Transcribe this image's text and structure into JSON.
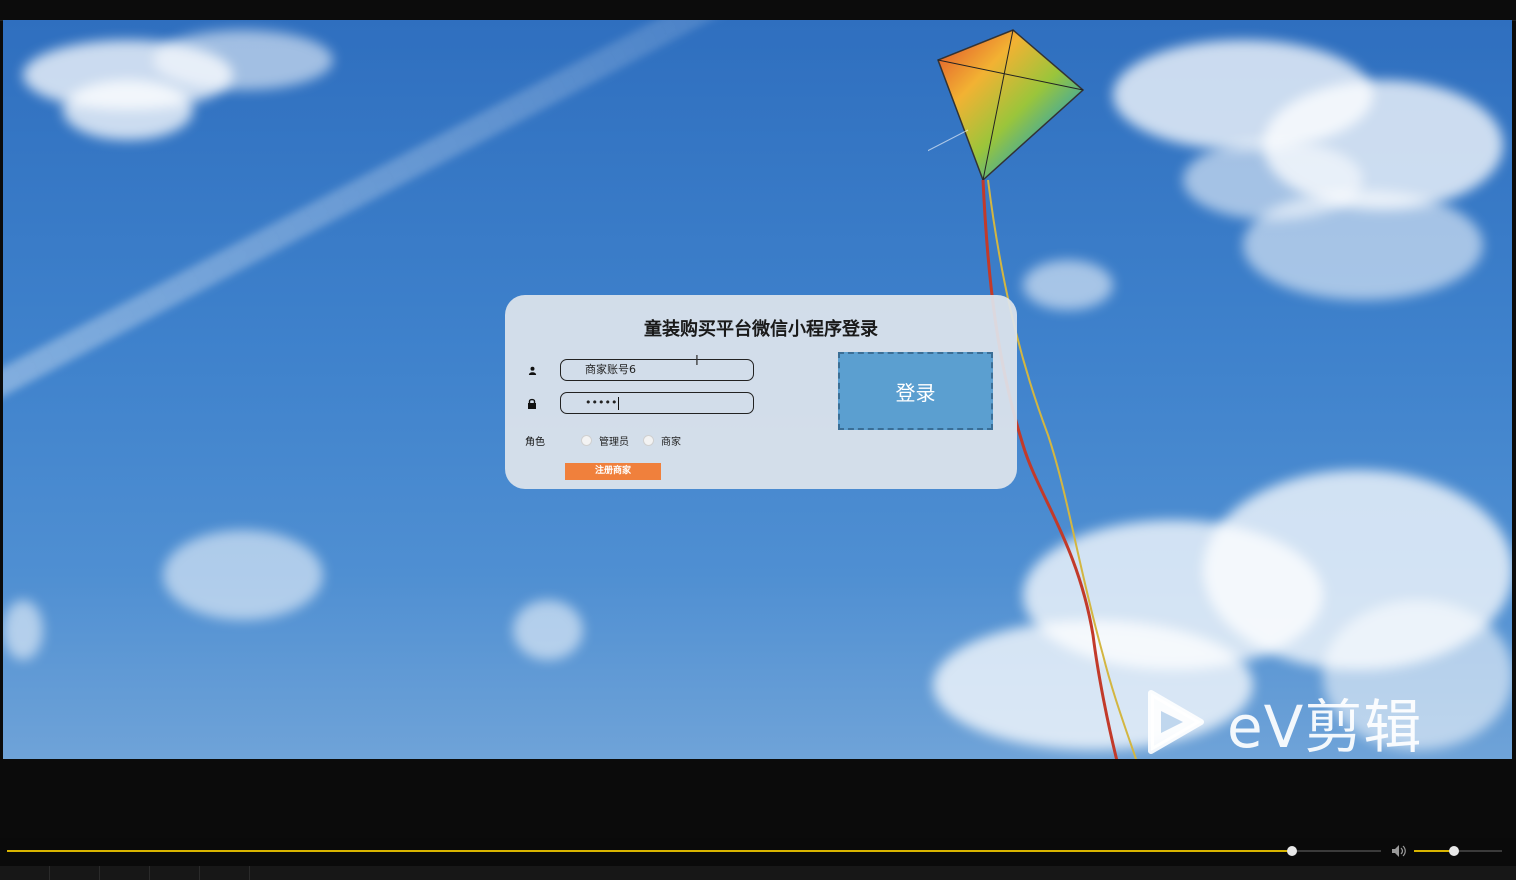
{
  "login": {
    "title": "童装购买平台微信小程序登录",
    "username_value": "商家账号6",
    "password_value": "•••••",
    "role_label": "角色",
    "roles": [
      {
        "label": "管理员"
      },
      {
        "label": "商家"
      }
    ],
    "login_button": "登录",
    "register_button": "注册商家"
  },
  "watermark": {
    "text": "eV剪辑"
  },
  "player": {
    "seek_progress": 0.935,
    "volume_level": 0.45
  },
  "colors": {
    "sky": "#3f82cc",
    "card": "#dee4ec",
    "login_button": "#5b9fd0",
    "register_button": "#f0803c",
    "progress": "#d8b400"
  },
  "icons": [
    "user-icon",
    "lock-icon",
    "play-logo-icon",
    "volume-icon"
  ]
}
